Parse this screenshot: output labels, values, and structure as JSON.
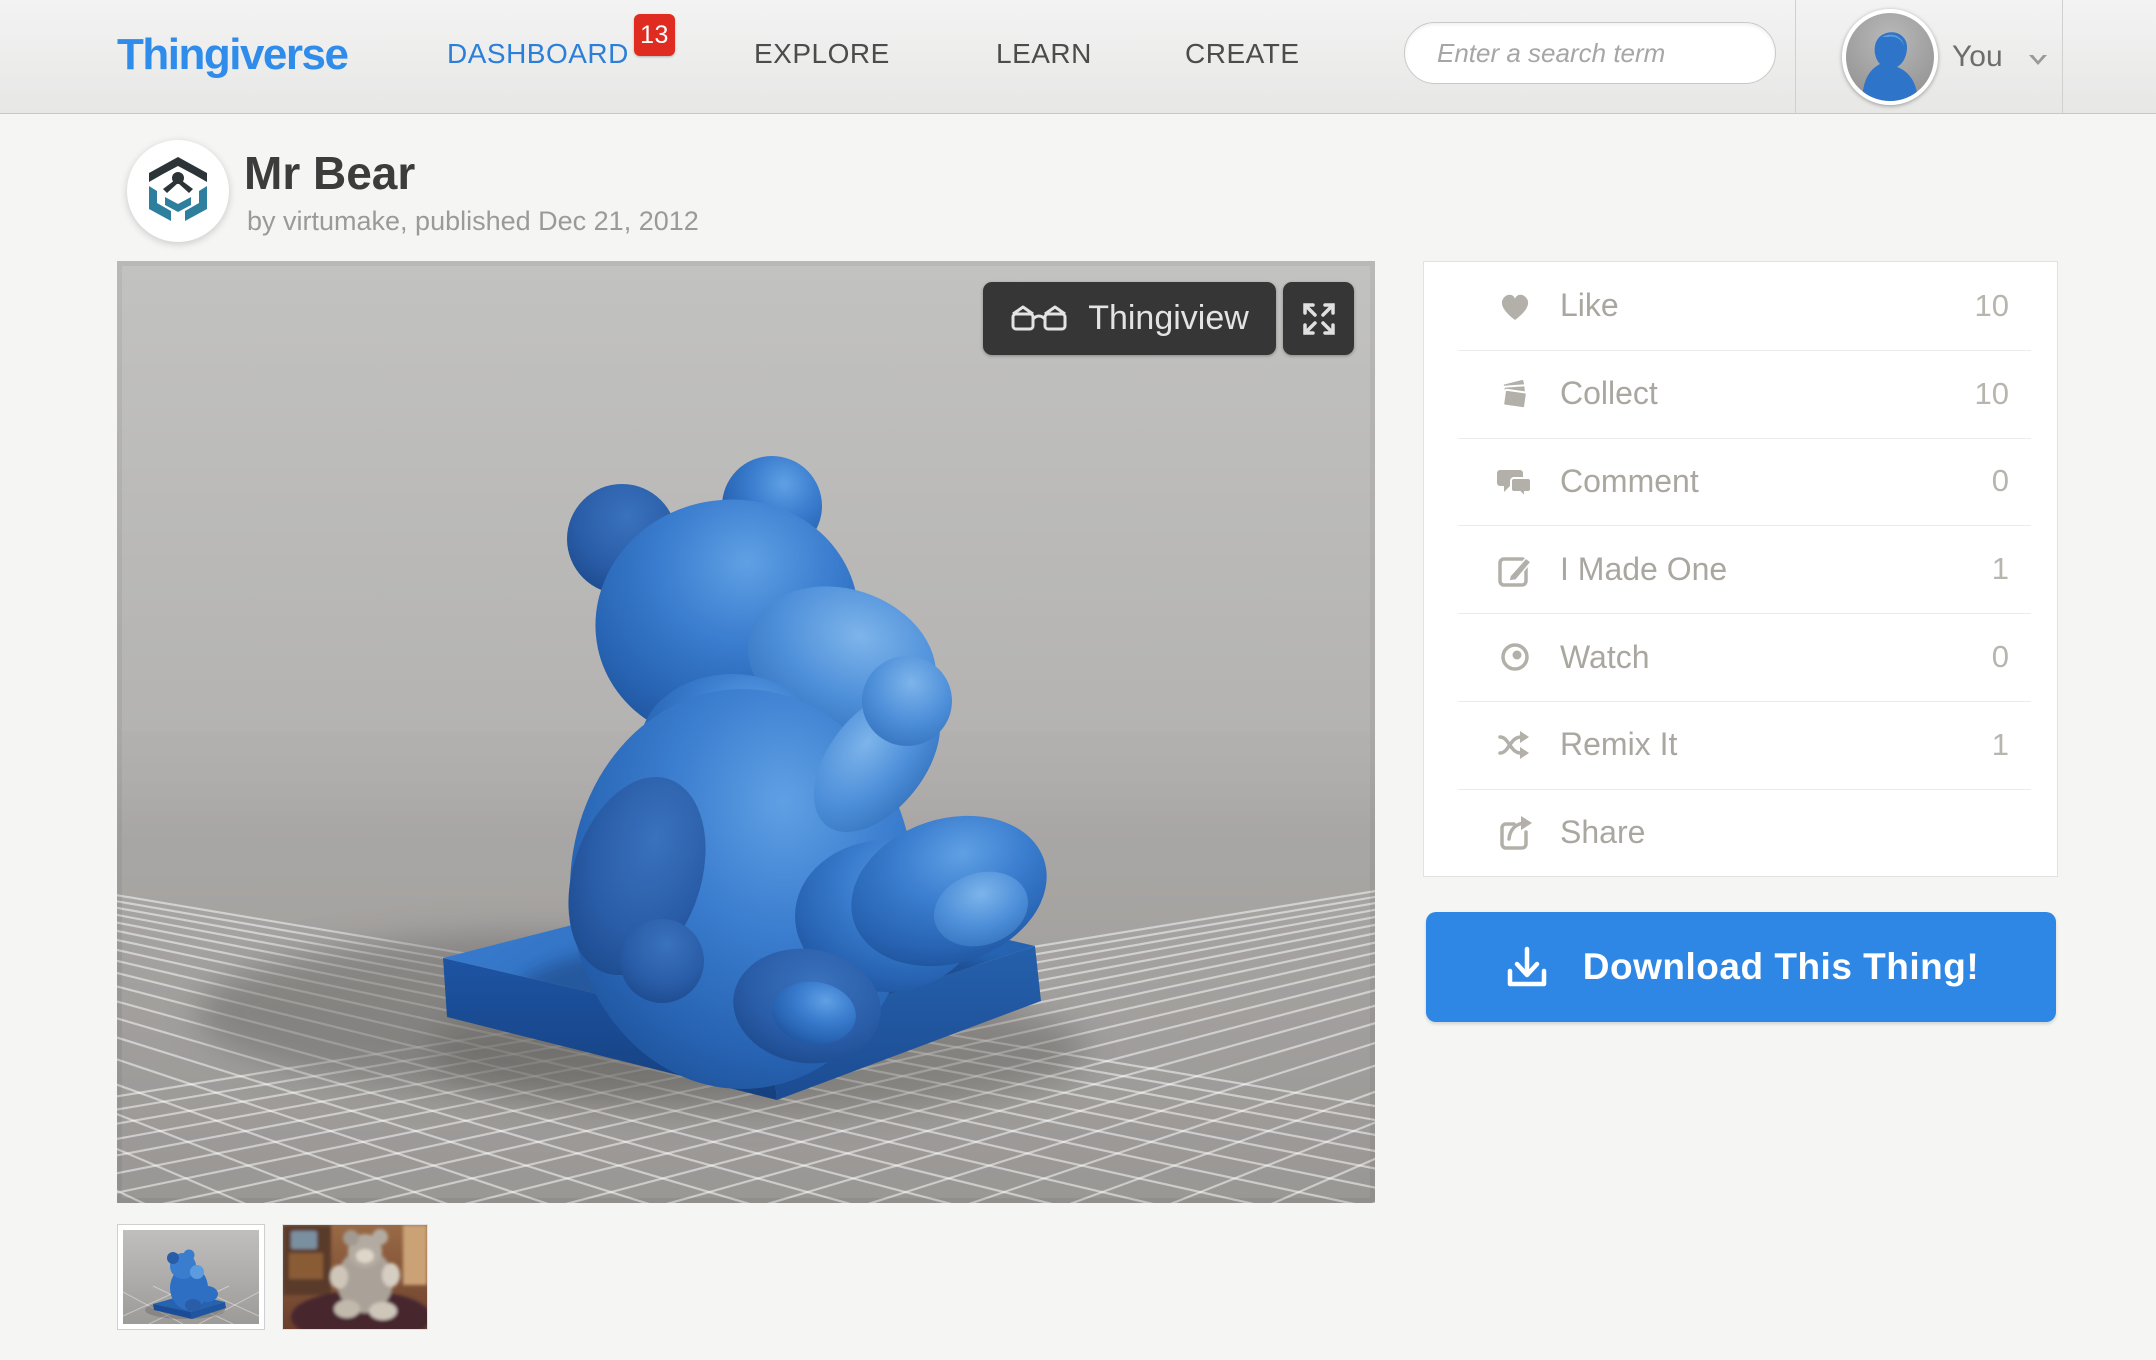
{
  "header": {
    "logo": "Thingiverse",
    "nav": [
      {
        "label": "DASHBOARD",
        "badge": "13"
      },
      {
        "label": "EXPLORE"
      },
      {
        "label": "LEARN"
      },
      {
        "label": "CREATE"
      }
    ],
    "search_placeholder": "Enter a search term",
    "user_label": "You"
  },
  "thing": {
    "title": "Mr Bear",
    "byline": "by virtumake, published Dec 21, 2012"
  },
  "viewer": {
    "thingiview_label": "Thingiview"
  },
  "actions": [
    {
      "icon": "heart-icon",
      "label": "Like",
      "count": "10"
    },
    {
      "icon": "collect-icon",
      "label": "Collect",
      "count": "10"
    },
    {
      "icon": "comment-icon",
      "label": "Comment",
      "count": "0"
    },
    {
      "icon": "made-one-icon",
      "label": "I Made One",
      "count": "1"
    },
    {
      "icon": "watch-icon",
      "label": "Watch",
      "count": "0"
    },
    {
      "icon": "remix-icon",
      "label": "Remix It",
      "count": "1"
    },
    {
      "icon": "share-icon",
      "label": "Share",
      "count": ""
    }
  ],
  "download": {
    "label": "Download This Thing!"
  },
  "colors": {
    "accent_blue": "#2e87e4",
    "logo_blue": "#2f8ceb",
    "nav_active_blue": "#2b7fd9",
    "badge_red": "#e02b20",
    "model_blue": "#2e6fc4",
    "viewport_gray": "#a8a6a3"
  }
}
